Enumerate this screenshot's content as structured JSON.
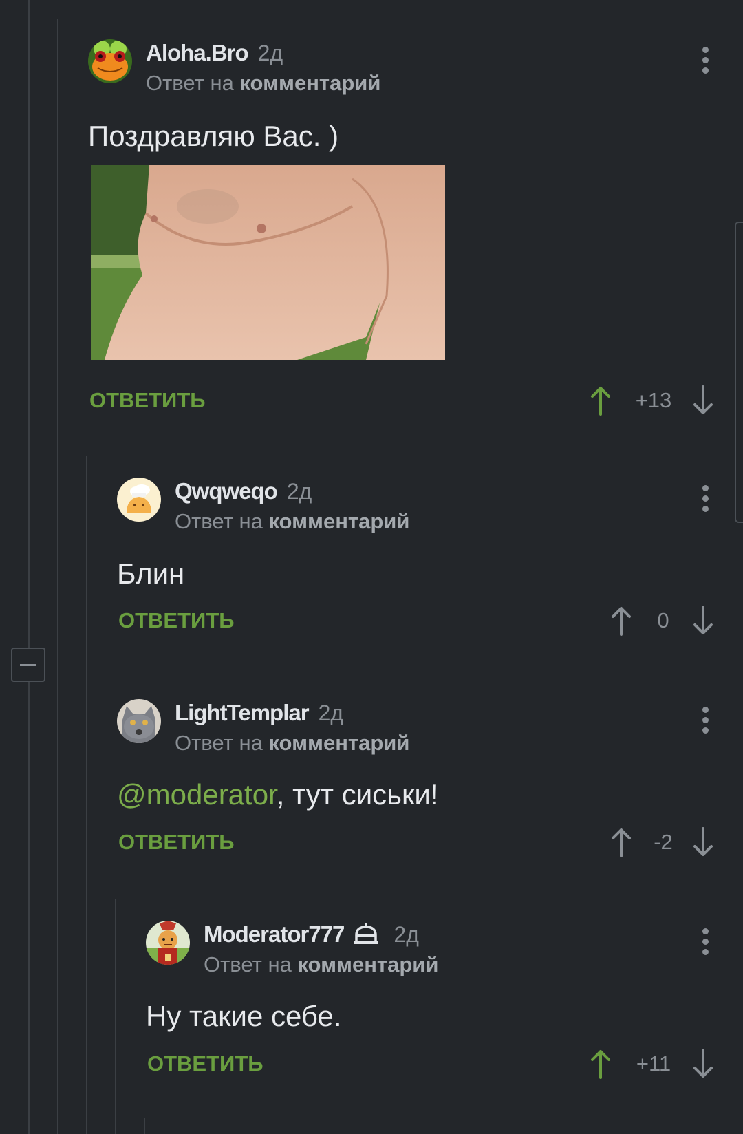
{
  "colors": {
    "background": "#23262a",
    "thread_line": "#3b3f44",
    "accent_green": "#6a9e3f",
    "mention_green": "#7cad4b",
    "muted": "#8a8f95",
    "text": "#e8eaed"
  },
  "comments": [
    {
      "author": "Aloha.Bro",
      "time": "2д",
      "reply_prefix": "Ответ на",
      "reply_target": "комментарий",
      "text": "Поздравляю Вас. )",
      "avatar_icon": "frog-avatar",
      "has_image": true,
      "reply_label": "ОТВЕТИТЬ",
      "rating": "+13",
      "upvoted": true
    },
    {
      "author": "Qwqweqo",
      "time": "2д",
      "reply_prefix": "Ответ на",
      "reply_target": "комментарий",
      "text": "Блин",
      "avatar_icon": "chef-avatar",
      "reply_label": "ОТВЕТИТЬ",
      "rating": "0",
      "upvoted": false
    },
    {
      "author": "LightTemplar",
      "time": "2д",
      "reply_prefix": "Ответ на",
      "reply_target": "комментарий",
      "mention": "@moderator",
      "text_after_mention": ", тут сиськи!",
      "avatar_icon": "cat-avatar",
      "reply_label": "ОТВЕТИТЬ",
      "rating": "-2",
      "upvoted": false
    },
    {
      "author": "Moderator777",
      "badge_icon": "moderator-cap-icon",
      "time": "2д",
      "reply_prefix": "Ответ на",
      "reply_target": "комментарий",
      "text": "Ну такие себе.",
      "avatar_icon": "samurai-avatar",
      "reply_label": "ОТВЕТИТЬ",
      "rating": "+11",
      "upvoted": true
    }
  ]
}
